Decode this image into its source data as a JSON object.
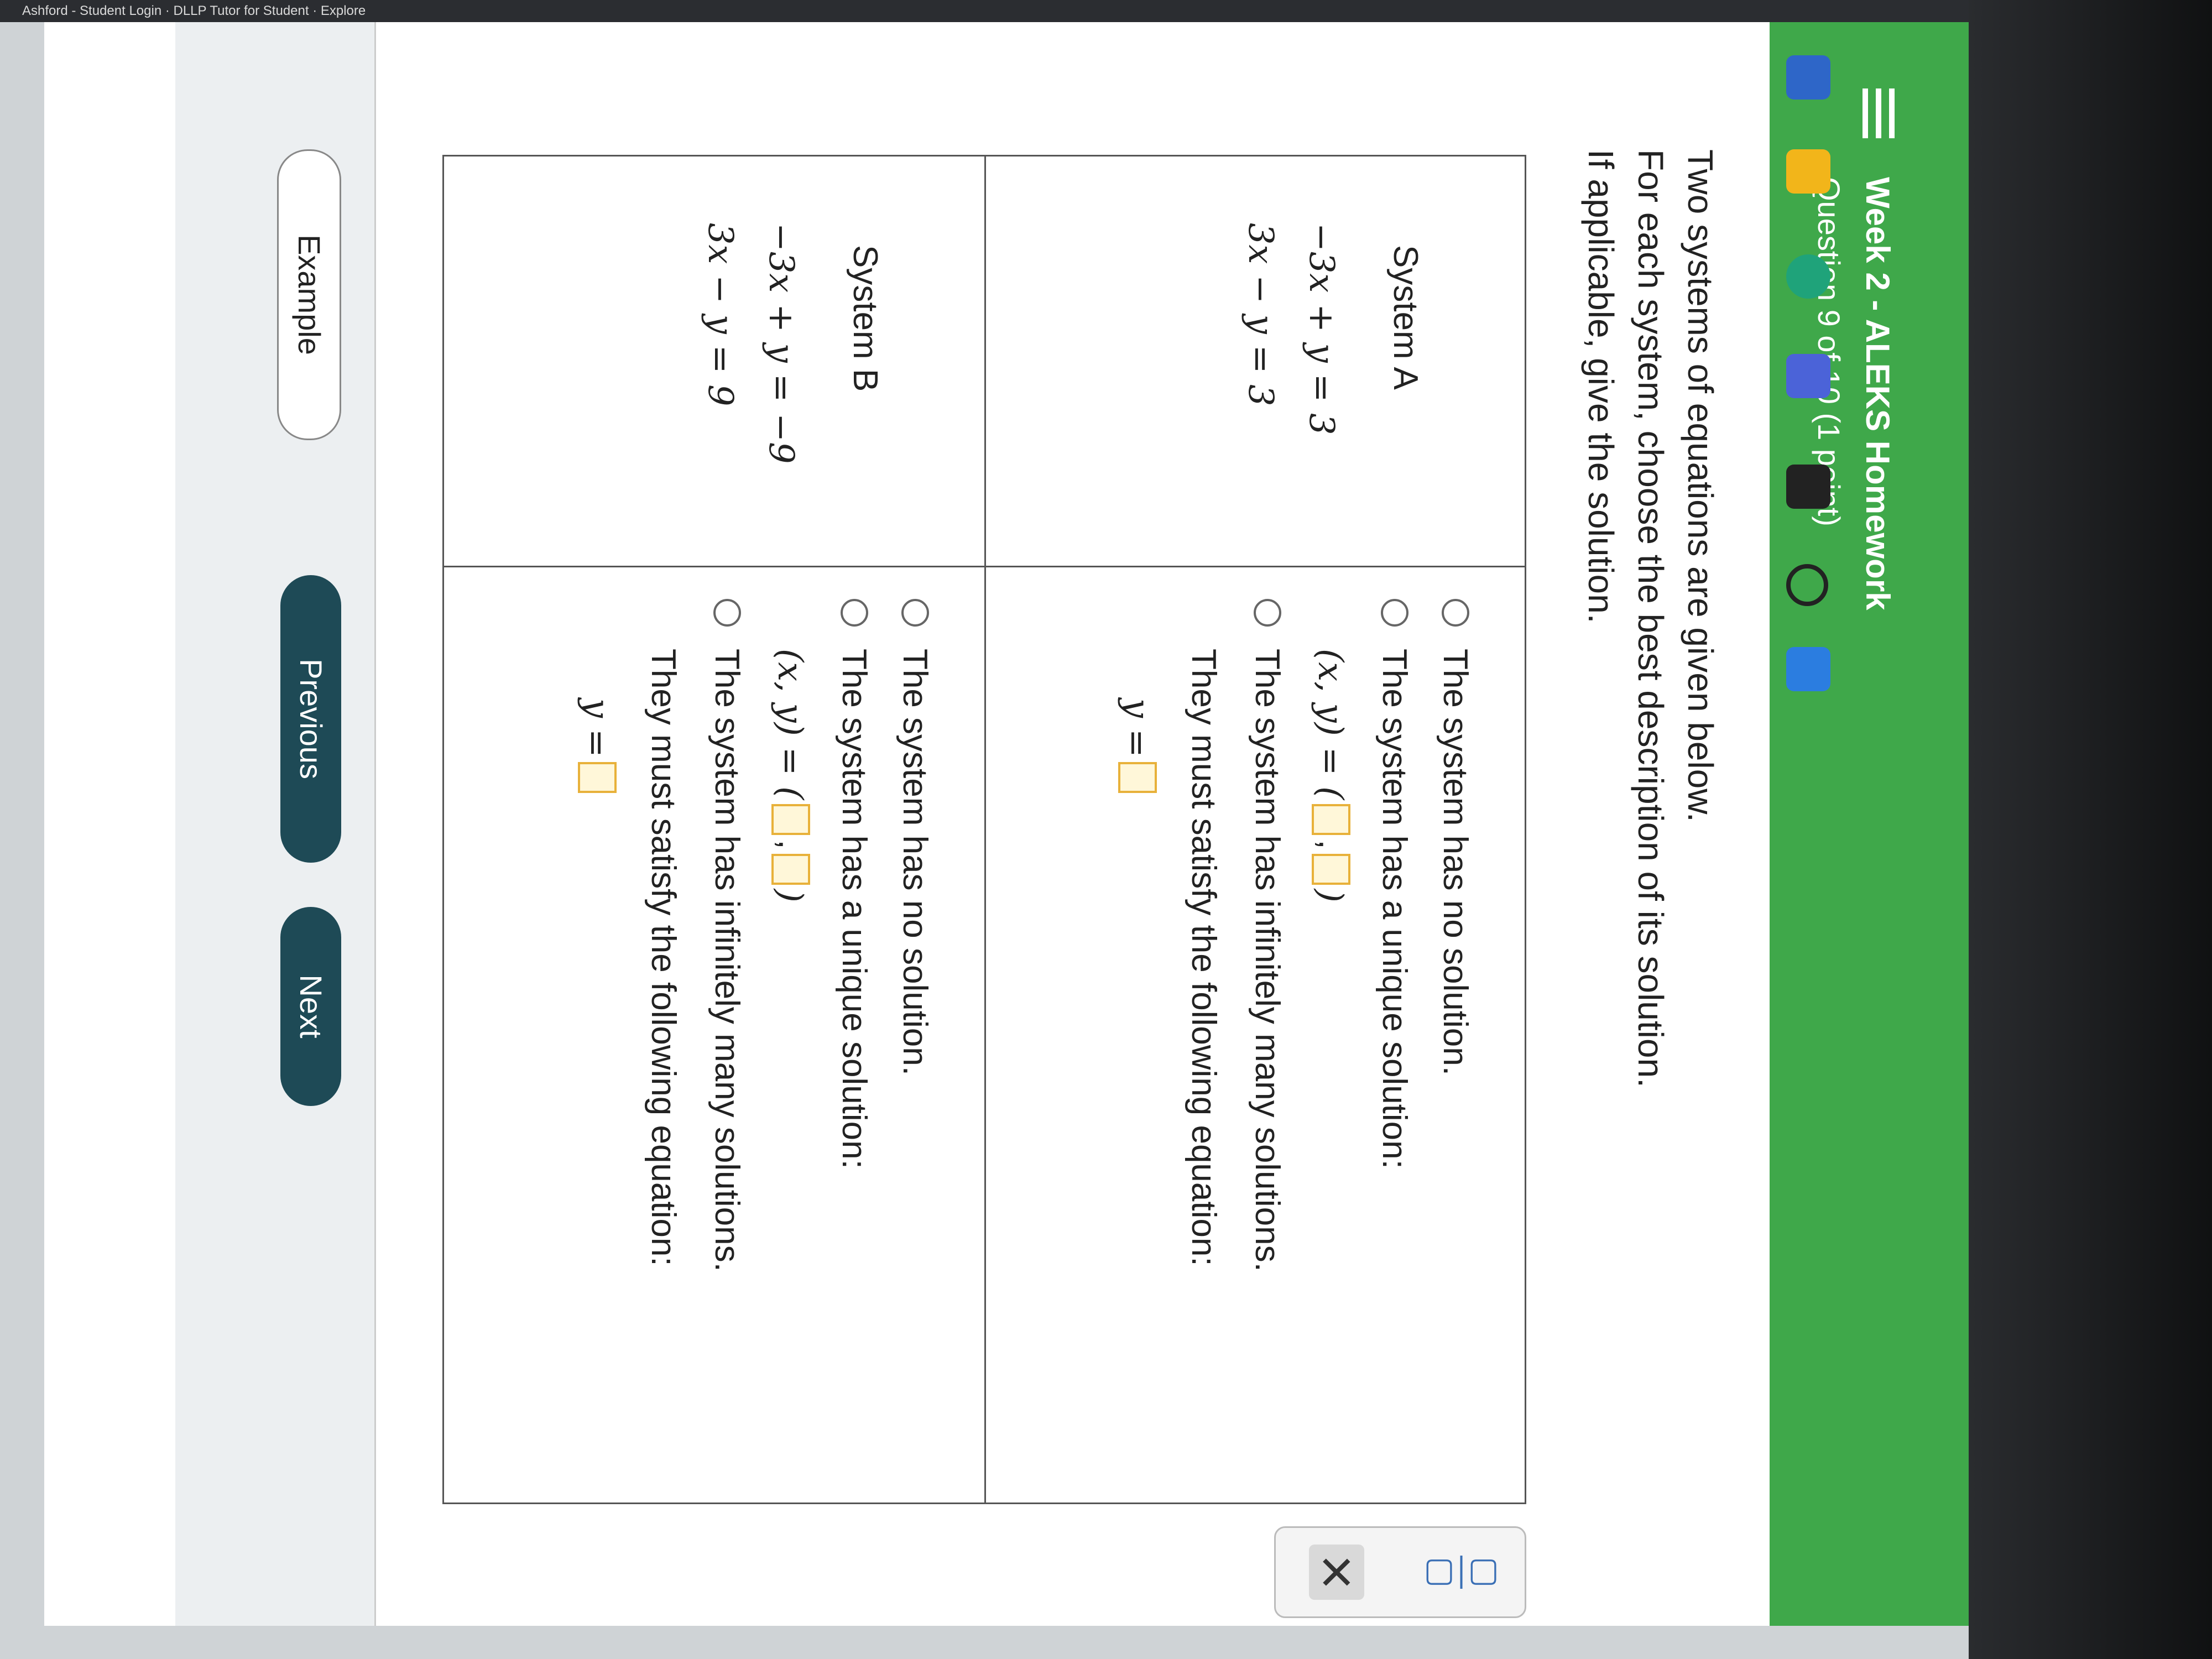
{
  "browser": {
    "tabs_text": "Ashford - Student Login   ·   DLLP Tutor for Student   ·   Explore"
  },
  "header": {
    "title": "Week 2 - ALEKS Homework",
    "subtitle": "Question 9 of 10 (1 point)"
  },
  "instructions": {
    "line1": "Two systems of equations are given below.",
    "line2": "For each system, choose the best description of its solution.",
    "line3": "If applicable, give the solution."
  },
  "system_a": {
    "label": "System A",
    "eq1": "−3x + y = 3",
    "eq2": "3x − y = 3",
    "options": {
      "no_solution": "The system has no solution.",
      "unique": "The system has a unique solution:",
      "unique_expr": "(x, y) =",
      "infinite": "The system has infinitely many solutions.",
      "satisfy": "They must satisfy the following equation:",
      "y_expr": "y ="
    }
  },
  "system_b": {
    "label": "System B",
    "eq1": "−3x + y = −9",
    "eq2": "3x − y = 9",
    "options": {
      "no_solution": "The system has no solution.",
      "unique": "The system has a unique solution:",
      "unique_expr": "(x, y) =",
      "infinite": "The system has infinitely many solutions.",
      "satisfy": "They must satisfy the following equation:",
      "y_expr": "y ="
    }
  },
  "toolbox": {
    "fraction_icon": "fraction-icon",
    "close_label": "×"
  },
  "footer": {
    "example": "Example",
    "previous": "Previous",
    "next": "Next"
  },
  "colors": {
    "header_green": "#3fa84a",
    "button_dark": "#1e4a56",
    "input_border": "#e8b13a"
  }
}
